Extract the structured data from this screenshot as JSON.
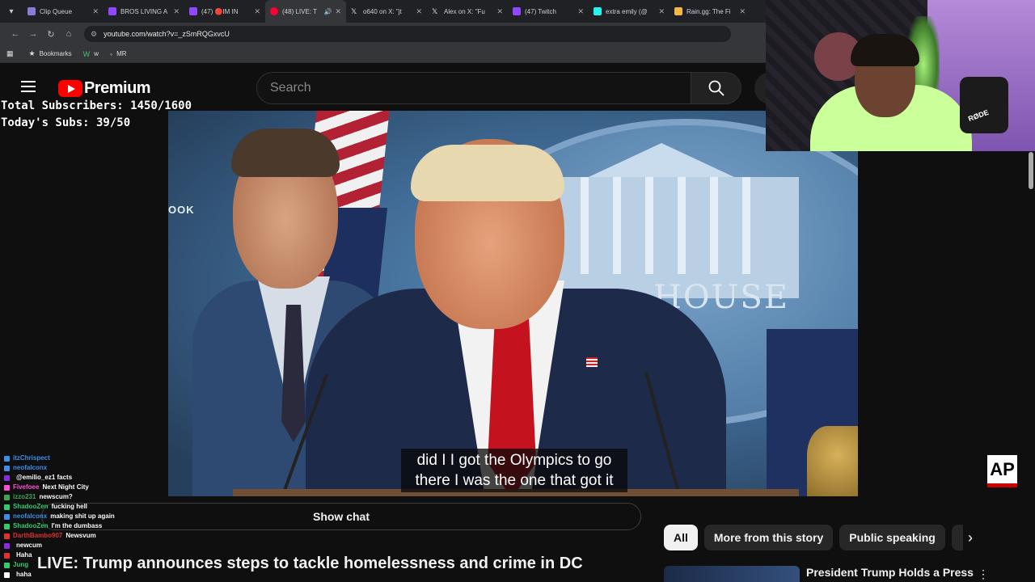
{
  "browser": {
    "tabs": [
      {
        "title": "Clip Queue",
        "color": "#8b7bd8"
      },
      {
        "title": "BROS LIVING A",
        "color": "#9146ff"
      },
      {
        "title": "(47) 🔴IM IN",
        "color": "#9146ff"
      },
      {
        "title": "(48) LIVE: T",
        "color": "#ff0033"
      },
      {
        "title": "o640 on X: \"jt",
        "color": "#e7e9ea"
      },
      {
        "title": "Alex on X: \"Fu",
        "color": "#e7e9ea"
      },
      {
        "title": "(47) Twitch",
        "color": "#9146ff"
      },
      {
        "title": "extra emily (@",
        "color": "#25f4ee"
      },
      {
        "title": "Rain.gg: The Fi",
        "color": "#f5b642"
      }
    ],
    "url": "youtube.com/watch?v=_zSmRQGxvcU",
    "bookmarks": [
      {
        "label": "Bookmarks",
        "icon": "star-icon"
      },
      {
        "label": "w",
        "icon": "w-icon"
      },
      {
        "label": "MR",
        "icon": "mr-icon"
      }
    ]
  },
  "youtube": {
    "logo_text": "Premium",
    "search_placeholder": "Search",
    "show_chat_label": "Show chat",
    "video_title": "LIVE: Trump announces steps to tackle homelessness and crime in DC",
    "chips": [
      "All",
      "More from this story",
      "Public speaking"
    ],
    "recommended_title": "President Trump Holds a Press"
  },
  "overlay": {
    "total_subs": "Total Subscribers: 1450/1600",
    "today_subs": "Today's Subs: 39/50"
  },
  "video": {
    "caption_line1": "did I I got the Olympics to go",
    "caption_line2": "there I was the one that got it",
    "bg_text_left": "OOK",
    "bg_text_house": "HOUSE",
    "watermark": "AP",
    "mic_brand": "RØDE"
  },
  "chat": [
    {
      "user": "itzChrispect",
      "color": "#3b8eea",
      "msg": ""
    },
    {
      "user": "neofalconx",
      "color": "#3b8eea",
      "msg": ""
    },
    {
      "user": "",
      "color": "#8a2be2",
      "msg": "@emilio_ez1 facts"
    },
    {
      "user": "Fivefoee",
      "color": "#ff4fd8",
      "msg": "Next Night City"
    },
    {
      "user": "izzo231",
      "color": "#3aa757",
      "msg": "newscum?"
    },
    {
      "user": "ShadooZen",
      "color": "#2ecc71",
      "msg": "fucking hell"
    },
    {
      "user": "neofalconx",
      "color": "#3b8eea",
      "msg": "making shit up again"
    },
    {
      "user": "ShadooZen",
      "color": "#2ecc71",
      "msg": "I'm the dumbass"
    },
    {
      "user": "DarthBambo907",
      "color": "#e03030",
      "msg": "Newsvum"
    },
    {
      "user": "",
      "color": "#8a2be2",
      "msg": "newcum"
    },
    {
      "user": "",
      "color": "#e03030",
      "msg": "Haha"
    },
    {
      "user": "Jung",
      "color": "#2ecc71",
      "msg": ""
    },
    {
      "user": "",
      "color": "#ffffff",
      "msg": "haha"
    }
  ]
}
